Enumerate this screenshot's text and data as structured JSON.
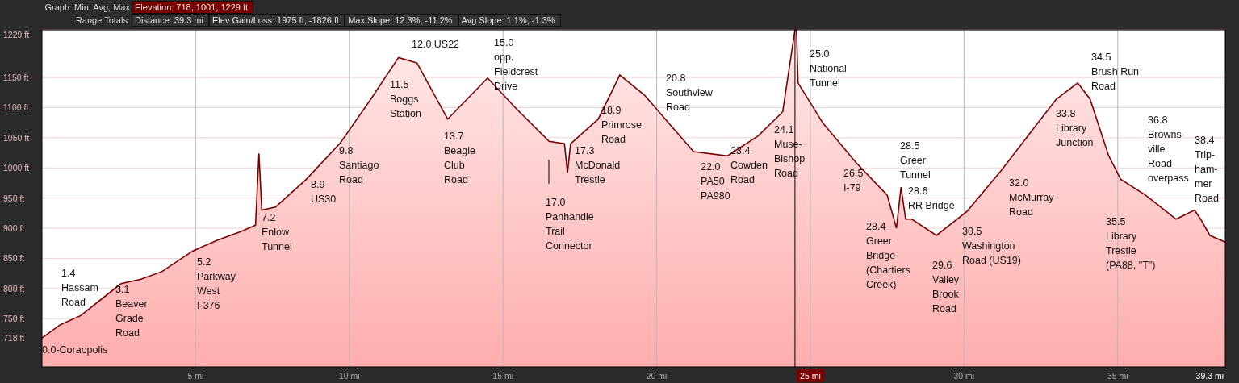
{
  "header": {
    "graph_label": "Graph: Min, Avg, Max",
    "graph_stat": {
      "text": "Elevation: 718, 1001, 1229 ft",
      "selected": true
    },
    "totals_label": "Range Totals:",
    "totals": [
      {
        "text": "Distance: 39.3 mi",
        "selected": false
      },
      {
        "text": "Elev Gain/Loss: 1975 ft, -1826 ft",
        "selected": false
      },
      {
        "text": "Max Slope: 12.3%, -11.2%",
        "selected": false
      },
      {
        "text": "Avg Slope: 1.1%, -1.3%",
        "selected": false
      }
    ]
  },
  "profile": {
    "chart_data": {
      "type": "area",
      "grid": true,
      "x": [
        0,
        0.6,
        1.26,
        2.0,
        2.57,
        3.2,
        3.9,
        4.9,
        5.7,
        6.5,
        6.95,
        7.06,
        7.15,
        7.6,
        8.6,
        9.7,
        10.7,
        11.6,
        12.2,
        13.2,
        14.5,
        15.4,
        16.5,
        17.0,
        17.1,
        17.2,
        18.1,
        18.8,
        19.6,
        20.4,
        21.2,
        22.3,
        23.3,
        24.1,
        24.5,
        24.55,
        24.6,
        25.4,
        26.5,
        27.5,
        27.8,
        27.95,
        28.1,
        28.3,
        29.1,
        30.1,
        31.2,
        32.2,
        33.0,
        33.7,
        34.1,
        34.7,
        35.1,
        35.9,
        36.9,
        37.5,
        37.7,
        38.0,
        38.5
      ],
      "series": [
        {
          "color": "#7a0000",
          "values": [
            718,
            740,
            755,
            785,
            808,
            815,
            828,
            862,
            880,
            895,
            905,
            1024,
            930,
            935,
            981,
            1041,
            1114,
            1183,
            1174,
            1081,
            1149,
            1100,
            1044,
            1040,
            992,
            1040,
            1081,
            1154,
            1121,
            1074,
            1027,
            1020,
            1053,
            1093,
            1229,
            1229,
            1141,
            1075,
            1008,
            955,
            900,
            968,
            915,
            915,
            888,
            928,
            995,
            1061,
            1114,
            1141,
            1114,
            1021,
            981,
            955,
            915,
            930,
            915,
            888,
            877
          ]
        }
      ],
      "xlim": [
        0,
        38.5
      ],
      "ylim": [
        670,
        1229
      ],
      "xticks": [
        {
          "value": 5,
          "label": "5 mi"
        },
        {
          "value": 10,
          "label": "10 mi"
        },
        {
          "value": 15,
          "label": "15 mi"
        },
        {
          "value": 20,
          "label": "20 mi"
        },
        {
          "value": 25,
          "label": "25 mi"
        },
        {
          "value": 30,
          "label": "30 mi"
        },
        {
          "value": 35,
          "label": "35 mi"
        }
      ],
      "yticks": [
        {
          "value": 718,
          "label": "718 ft"
        },
        {
          "value": 750,
          "label": "750 ft"
        },
        {
          "value": 800,
          "label": "800 ft"
        },
        {
          "value": 850,
          "label": "850 ft"
        },
        {
          "value": 900,
          "label": "900 ft"
        },
        {
          "value": 950,
          "label": "950 ft"
        },
        {
          "value": 1000,
          "label": "1000 ft"
        },
        {
          "value": 1050,
          "label": "1050 ft"
        },
        {
          "value": 1100,
          "label": "1100 ft"
        },
        {
          "value": 1150,
          "label": "1150 ft"
        },
        {
          "value": 1229,
          "label": "1229 ft"
        }
      ],
      "ref_lines": [
        {
          "axis": "x",
          "value": 24.5,
          "color": "#000000"
        }
      ]
    },
    "distance_label": "39.3 mi",
    "waypoints": [
      {
        "lines": [
          "1.4",
          "Hassam",
          "Road"
        ]
      },
      {
        "lines": [
          "0.0-Coraopolis"
        ]
      },
      {
        "lines": [
          "3.1",
          "Beaver",
          "Grade",
          "Road"
        ]
      },
      {
        "lines": [
          "5.2",
          "Parkway",
          "West",
          "I-376"
        ]
      },
      {
        "lines": [
          "7.2",
          "Enlow",
          "Tunnel"
        ]
      },
      {
        "lines": [
          "8.9",
          "US30"
        ]
      },
      {
        "lines": [
          "9.8",
          "Santiago",
          "Road"
        ]
      },
      {
        "lines": [
          "11.5",
          "Boggs",
          "Station"
        ]
      },
      {
        "lines": [
          "12.0 US22"
        ]
      },
      {
        "lines": [
          "13.7",
          "Beagle",
          "Club",
          "Road"
        ]
      },
      {
        "lines": [
          "15.0",
          "opp.",
          "Fieldcrest",
          "Drive"
        ]
      },
      {
        "lines": [
          "17.0",
          "Panhandle",
          "Trail",
          "Connector"
        ],
        "leader": true
      },
      {
        "lines": [
          "17.3",
          "McDonald",
          "Trestle"
        ]
      },
      {
        "lines": [
          "18.9",
          "Primrose",
          "Road"
        ]
      },
      {
        "lines": [
          "20.8",
          "Southview",
          "Road"
        ]
      },
      {
        "lines": [
          "22.0",
          "PA50",
          "PA980"
        ]
      },
      {
        "lines": [
          "23.4",
          "Cowden",
          "Road"
        ]
      },
      {
        "lines": [
          "24.1",
          "Muse-",
          "Bishop",
          "Road"
        ]
      },
      {
        "lines": [
          "25.0",
          "National",
          "Tunnel"
        ]
      },
      {
        "lines": [
          "26.5",
          "I-79"
        ]
      },
      {
        "lines": [
          "28.5",
          "Greer",
          "Tunnel"
        ]
      },
      {
        "lines": [
          "28.6",
          "RR Bridge"
        ]
      },
      {
        "lines": [
          "28.4",
          "Greer",
          "Bridge",
          "(Chartiers",
          "Creek)"
        ]
      },
      {
        "lines": [
          "29.6",
          "Valley",
          "Brook",
          "Road"
        ]
      },
      {
        "lines": [
          "30.5",
          "Washington",
          "Road (US19)"
        ]
      },
      {
        "lines": [
          "32.0",
          "McMurray",
          "Road"
        ]
      },
      {
        "lines": [
          "33.8",
          "Library",
          "Junction"
        ]
      },
      {
        "lines": [
          "34.5",
          "Brush Run",
          "Road"
        ]
      },
      {
        "lines": [
          "35.5",
          "Library",
          "Trestle",
          "(PA88, \"T\")"
        ]
      },
      {
        "lines": [
          "36.8",
          "Browns-",
          "ville",
          "Road",
          "overpass"
        ]
      },
      {
        "lines": [
          "38.4",
          "Trip-",
          "ham-",
          "mer",
          "Road"
        ]
      }
    ]
  }
}
